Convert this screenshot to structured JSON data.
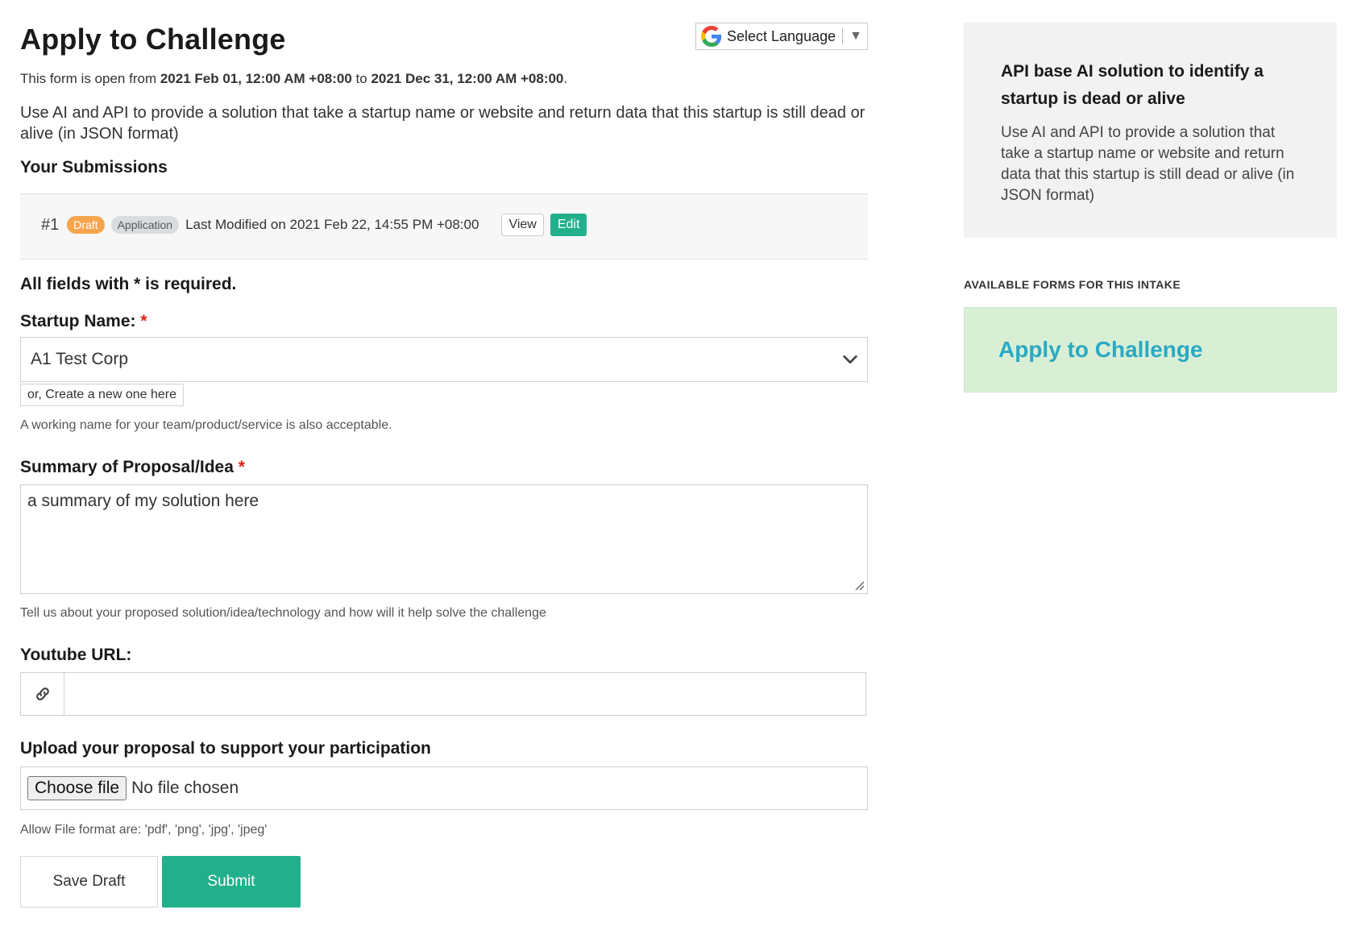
{
  "header": {
    "title": "Apply to Challenge",
    "language_label": "Select Language",
    "open_prefix": "This form is open from ",
    "open_from": "2021 Feb 01, 12:00 AM +08:00",
    "open_to_word": " to ",
    "open_to": "2021 Dec 31, 12:00 AM +08:00",
    "open_suffix": ".",
    "description": "Use AI and API to provide a solution that take a startup name or website and return data that this startup is still dead or alive (in JSON format)"
  },
  "submissions": {
    "heading": "Your Submissions",
    "items": [
      {
        "number": "#1",
        "status_badge": "Draft",
        "type_badge": "Application",
        "modified": "Last Modified on 2021 Feb 22, 14:55 PM +08:00",
        "view_label": "View",
        "edit_label": "Edit"
      }
    ]
  },
  "form": {
    "required_note": "All fields with * is required.",
    "startup": {
      "label": "Startup Name:",
      "required_mark": "*",
      "selected": "A1 Test Corp",
      "create_label": "or, Create a new one here",
      "help": "A working name for your team/product/service is also acceptable."
    },
    "summary": {
      "label": "Summary of Proposal/Idea",
      "required_mark": "*",
      "value": "a summary of my solution here",
      "help": "Tell us about your proposed solution/idea/technology and how will it help solve the challenge"
    },
    "youtube": {
      "label": "Youtube URL:",
      "value": "",
      "icon": "link-icon"
    },
    "upload": {
      "label": "Upload your proposal to support your participation",
      "button": "Choose file",
      "status": "No file chosen",
      "help": "Allow File format are: 'pdf', 'png', 'jpg', 'jpeg'"
    },
    "actions": {
      "save_label": "Save Draft",
      "submit_label": "Submit"
    }
  },
  "sidebar": {
    "card_title": "API base AI solution to identify a startup is dead or alive",
    "card_text": "Use AI and API to provide a solution that take a startup name or website and return data that this startup is still dead or alive (in JSON format)",
    "forms_heading": "AVAILABLE FORMS FOR THIS INTAKE",
    "forms": [
      {
        "label": "Apply to Challenge"
      }
    ]
  },
  "colors": {
    "accent_green": "#22b08c",
    "draft_orange": "#f6a54c",
    "link_teal": "#2ba9c2",
    "form_card_bg": "#d8efd6",
    "required_red": "#e02020"
  }
}
